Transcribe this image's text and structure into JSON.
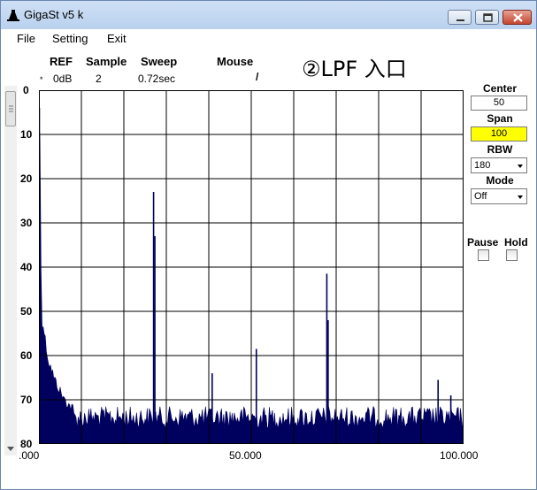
{
  "window": {
    "title": "GigaSt v5 k"
  },
  "menu": {
    "file": "File",
    "setting": "Setting",
    "exit": "Exit"
  },
  "header": {
    "ref_label": "REF",
    "ref_marker": "*",
    "ref_value": "0dB",
    "sample_label": "Sample",
    "sample_value": "2",
    "sweep_label": "Sweep",
    "sweep_value": "0.72sec",
    "mouse_label": "Mouse",
    "mouse_value": "/"
  },
  "annotation": "②LPF 入口",
  "controls": {
    "center_label": "Center",
    "center_value": "50",
    "span_label": "Span",
    "span_value": "100",
    "rbw_label": "RBW",
    "rbw_value": "180",
    "mode_label": "Mode",
    "mode_value": "Off",
    "pause_label": "Pause",
    "hold_label": "Hold"
  },
  "colors": {
    "trace": "#00005f",
    "grid": "#000000",
    "span_field": "#ffff00"
  },
  "chart_data": {
    "type": "area",
    "x_ticks": [
      ".000",
      "50.000",
      "100.000"
    ],
    "y_ticks": [
      "0",
      "10",
      "20",
      "30",
      "40",
      "50",
      "60",
      "70",
      "80"
    ],
    "xlim": [
      0,
      100
    ],
    "ylim": [
      0,
      80
    ],
    "y_inverted": true,
    "grid": true,
    "noise_floor": 74,
    "spectrum": {
      "x": [
        0.2,
        0.4,
        0.6,
        0.8,
        1.0,
        1.3,
        1.6,
        2.0,
        2.5,
        3.0,
        3.5,
        4.0,
        4.5,
        5.0,
        6.0,
        7.0,
        8.0
      ],
      "y": [
        5,
        33,
        48,
        54,
        53,
        55,
        57,
        60,
        62,
        63,
        65,
        66,
        67,
        68,
        70,
        71,
        72
      ]
    },
    "peaks": [
      {
        "x": 0.1,
        "y": 4
      },
      {
        "x": 27.0,
        "y": 23
      },
      {
        "x": 27.3,
        "y": 33
      },
      {
        "x": 40.8,
        "y": 64
      },
      {
        "x": 51.2,
        "y": 58.5
      },
      {
        "x": 67.8,
        "y": 41.5
      },
      {
        "x": 68.1,
        "y": 52
      },
      {
        "x": 94.0,
        "y": 65.5
      },
      {
        "x": 97.0,
        "y": 69
      }
    ]
  }
}
